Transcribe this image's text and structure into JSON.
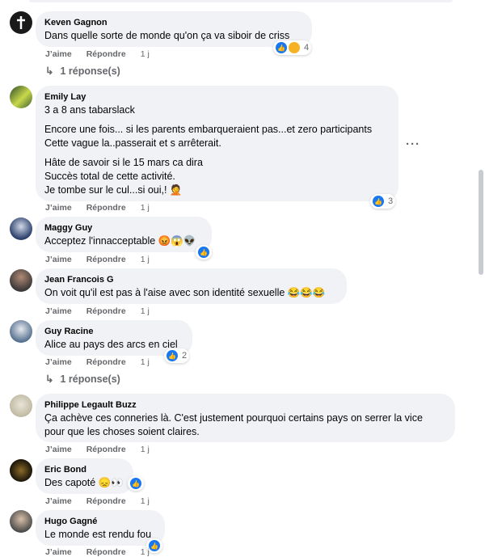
{
  "colors": {
    "bubble": "#f0f2f5",
    "like": "#1877f2",
    "meta": "#65676b"
  },
  "actions": {
    "like": "J’aime",
    "reply": "Répondre"
  },
  "comments": [
    {
      "author": "Keven Gagnon",
      "lines": [
        "Dans quelle sorte de monde qu'on ça va siboir de criss"
      ],
      "time": "1 j",
      "reactions": "4",
      "reaction_icons": [
        "like-icon",
        "sad-icon"
      ],
      "replies": "1 réponse(s)"
    },
    {
      "author": "Emily Lay",
      "paragraphs": [
        [
          "3 a 8 ans tabarslack"
        ],
        [
          "Encore une fois... si les parents embarqueraient pas...et zero participants",
          "Cette vague la..passerait et s arrêterait."
        ],
        [
          "Hâte de savoir si le 15 mars ca dira",
          "Succès total de cette activité.",
          "Je tombe sur le cul...si oui,! 🤦"
        ]
      ],
      "time": "1 j",
      "reactions": "3"
    },
    {
      "author": "Maggy Guy",
      "lines": [
        "Acceptez l'innacceptable 😡😱👽"
      ],
      "time": "1 j"
    },
    {
      "author": "Jean Francois G",
      "lines": [
        "On voit qu'il est pas à l'aise avec son identité sexuelle 😂😂😂"
      ],
      "time": "1 j"
    },
    {
      "author": "Guy Racine",
      "lines": [
        "Alice au pays des arcs en ciel"
      ],
      "time": "1 j",
      "reactions": "2",
      "replies": "1 réponse(s)"
    },
    {
      "author": "Philippe Legault Buzz",
      "lines": [
        "Ça achève ces conneries là. C'est justement pourquoi certains pays on serrer la vice",
        "pour que les choses soient claires."
      ],
      "time": "1 j"
    },
    {
      "author": "Eric Bond",
      "lines": [
        "Des capoté 😞👀"
      ],
      "time": "1 j"
    },
    {
      "author": "Hugo Gagné",
      "lines": [
        "Le monde est rendu fou"
      ],
      "time": "1 j"
    }
  ]
}
